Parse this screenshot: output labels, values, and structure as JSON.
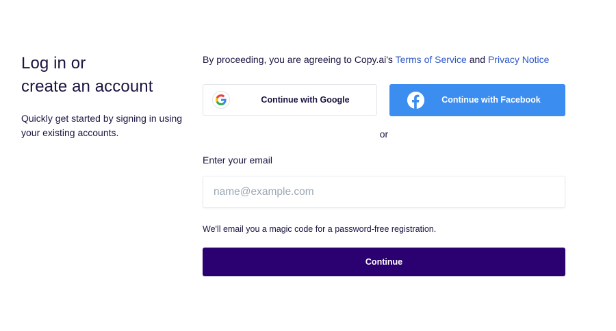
{
  "intro": {
    "heading_line1": "Log in or",
    "heading_line2": "create an account",
    "subtext": "Quickly get started by signing in using your existing accounts."
  },
  "terms": {
    "prefix": "By proceeding, you are agreeing to Copy.ai's ",
    "tos_link": "Terms of Service",
    "and": " and ",
    "privacy_link": "Privacy Notice"
  },
  "social": {
    "google_label": "Continue with Google",
    "google_icon": "google-icon",
    "facebook_label": "Continue with Facebook",
    "facebook_icon": "facebook-icon",
    "facebook_color": "#3b8df0"
  },
  "divider": {
    "or_label": "or"
  },
  "email": {
    "label": "Enter your email",
    "value": "",
    "placeholder": "name@example.com",
    "hint": "We'll email you a magic code for a password-free registration."
  },
  "submit": {
    "label": "Continue",
    "color": "#2b0070"
  }
}
